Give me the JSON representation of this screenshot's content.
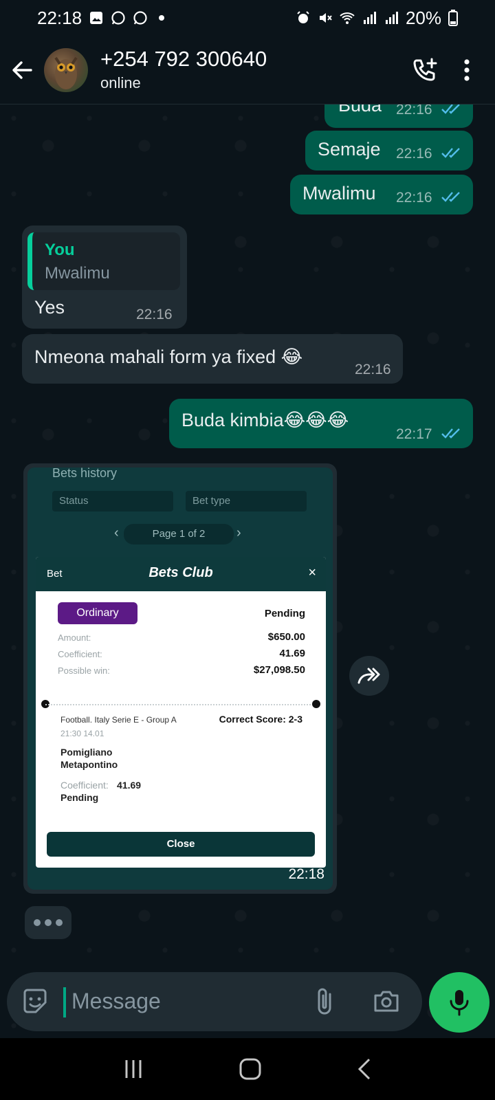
{
  "status_bar": {
    "time": "22:18",
    "battery": "20%"
  },
  "header": {
    "contact_name": "+254 792 300640",
    "status": "online"
  },
  "messages": [
    {
      "dir": "out",
      "text": "Buda",
      "time": "22:16",
      "ticks": "read"
    },
    {
      "dir": "out",
      "text": "Semaje",
      "time": "22:16",
      "ticks": "read"
    },
    {
      "dir": "out",
      "text": "Mwalimu",
      "time": "22:16",
      "ticks": "read"
    },
    {
      "dir": "in",
      "quote_author": "You",
      "quote_text": "Mwalimu",
      "text": "Yes",
      "time": "22:16"
    },
    {
      "dir": "in",
      "text": "Nmeona mahali form ya fixed 😂",
      "time": "22:16"
    },
    {
      "dir": "out",
      "text": "Buda kimbia😂😂😂",
      "time": "22:17",
      "ticks": "read"
    }
  ],
  "image_message": {
    "time": "22:18",
    "screenshot": {
      "history_title": "Bets history",
      "status_placeholder": "Status",
      "bettype_placeholder": "Bet type",
      "pager": "Page 1 of 2",
      "modal_tab": "Bet",
      "modal_title": "Bets Club",
      "pill": "Ordinary",
      "state": "Pending",
      "amount_label": "Amount:",
      "amount": "$650.00",
      "coef_label": "Coefficient:",
      "coef": "41.69",
      "win_label": "Possible win:",
      "win": "$27,098.50",
      "league": "Football. Italy Serie E - Group A",
      "date": "21:30 14.01",
      "market": "Correct Score: 2-3",
      "team1": "Pomigliano",
      "team2": "Metapontino",
      "sel_coef_label": "Coefficient:",
      "sel_coef": "41.69",
      "sel_state": "Pending",
      "close": "Close"
    }
  },
  "composer": {
    "placeholder": "Message"
  },
  "colors": {
    "outgoing": "#005c4b",
    "incoming": "#202c33",
    "accent": "#21c063",
    "read_ticks": "#53bdeb"
  }
}
